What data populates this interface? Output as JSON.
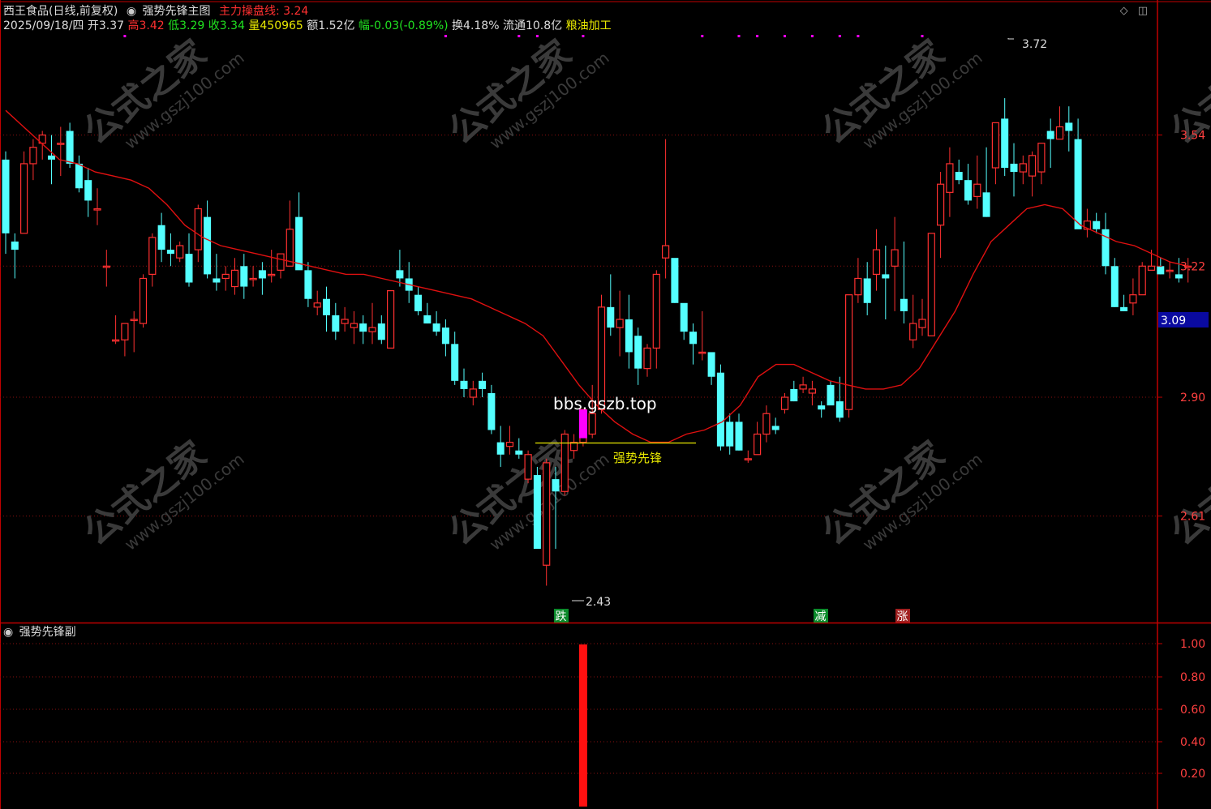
{
  "header": {
    "stock_name": "西王食品(日线,前复权)",
    "indicator_name": "强势先锋主图",
    "ma_label": "主力操盘线:",
    "ma_value": "3.24",
    "date": "2025/09/18/四",
    "open_label": "开",
    "open": "3.37",
    "high_label": "高",
    "high": "3.42",
    "low_label": "低",
    "low": "3.29",
    "close_label": "收",
    "close": "3.34",
    "volume_label": "量",
    "volume": "450965",
    "amount_label": "额",
    "amount": "1.52亿",
    "change_label": "幅",
    "change": "-0.03(-0.89%)",
    "turnover_label": "换",
    "turnover": "4.18%",
    "float_label": "流通",
    "float_cap": "10.8亿",
    "sector": "粮油加工"
  },
  "icons": {
    "diamond": "diamond-icon",
    "window": "window-toggle-icon"
  },
  "main_axis": {
    "ticks": [
      "3.54",
      "3.22",
      "2.90",
      "2.61"
    ],
    "current_price": "3.09"
  },
  "annotations": {
    "max_label": "3.72",
    "min_label": "2.43",
    "watermark_text": "bbs.gszb.top",
    "signal_label": "强势先锋",
    "marker_die": "跌",
    "marker_jian": "减",
    "marker_zhang": "涨",
    "wm1": "公式之家",
    "wm2": "www.gszj100.com"
  },
  "sub_panel": {
    "title": "强势先锋副",
    "ticks": [
      "1.00",
      "0.80",
      "0.60",
      "0.40",
      "0.20"
    ]
  },
  "colors": {
    "up": "#ff3030",
    "down": "#54ffff",
    "ma": "#e01010",
    "signal": "#ff00ff",
    "sub_bar": "#ff1010"
  },
  "chart_data": {
    "type": "candlestick",
    "ylim": [
      2.35,
      3.83
    ],
    "ohlc": [
      [
        3.48,
        3.5,
        3.25,
        3.3
      ],
      [
        3.28,
        3.3,
        3.19,
        3.26
      ],
      [
        3.3,
        3.5,
        3.3,
        3.47
      ],
      [
        3.47,
        3.53,
        3.43,
        3.51
      ],
      [
        3.52,
        3.55,
        3.48,
        3.54
      ],
      [
        3.49,
        3.54,
        3.42,
        3.48
      ],
      [
        3.52,
        3.56,
        3.44,
        3.52
      ],
      [
        3.55,
        3.57,
        3.46,
        3.47
      ],
      [
        3.47,
        3.49,
        3.4,
        3.41
      ],
      [
        3.43,
        3.46,
        3.34,
        3.38
      ],
      [
        3.36,
        3.41,
        3.32,
        3.36
      ],
      [
        3.22,
        3.26,
        3.17,
        3.22
      ],
      [
        3.04,
        3.1,
        3.03,
        3.04
      ],
      [
        3.04,
        3.08,
        3.0,
        3.08
      ],
      [
        3.09,
        3.11,
        3.01,
        3.09
      ],
      [
        3.08,
        3.2,
        3.07,
        3.19
      ],
      [
        3.2,
        3.3,
        3.17,
        3.29
      ],
      [
        3.32,
        3.35,
        3.23,
        3.26
      ],
      [
        3.26,
        3.3,
        3.22,
        3.25
      ],
      [
        3.24,
        3.28,
        3.23,
        3.27
      ],
      [
        3.25,
        3.3,
        3.17,
        3.18
      ],
      [
        3.26,
        3.37,
        3.23,
        3.36
      ],
      [
        3.34,
        3.38,
        3.19,
        3.2
      ],
      [
        3.19,
        3.25,
        3.16,
        3.18
      ],
      [
        3.19,
        3.22,
        3.16,
        3.2
      ],
      [
        3.17,
        3.24,
        3.15,
        3.21
      ],
      [
        3.22,
        3.25,
        3.14,
        3.17
      ],
      [
        3.19,
        3.22,
        3.17,
        3.19
      ],
      [
        3.21,
        3.23,
        3.15,
        3.19
      ],
      [
        3.2,
        3.26,
        3.18,
        3.2
      ],
      [
        3.21,
        3.25,
        3.19,
        3.25
      ],
      [
        3.22,
        3.38,
        3.22,
        3.31
      ],
      [
        3.34,
        3.4,
        3.25,
        3.21
      ],
      [
        3.21,
        3.23,
        3.12,
        3.14
      ],
      [
        3.12,
        3.16,
        3.1,
        3.13
      ],
      [
        3.14,
        3.17,
        3.06,
        3.1
      ],
      [
        3.1,
        3.13,
        3.04,
        3.06
      ],
      [
        3.08,
        3.12,
        3.06,
        3.09
      ],
      [
        3.07,
        3.11,
        3.03,
        3.08
      ],
      [
        3.08,
        3.1,
        3.03,
        3.06
      ],
      [
        3.06,
        3.13,
        3.03,
        3.07
      ],
      [
        3.08,
        3.1,
        3.03,
        3.04
      ],
      [
        3.02,
        3.16,
        3.02,
        3.16
      ],
      [
        3.21,
        3.26,
        3.17,
        3.19
      ],
      [
        3.19,
        3.23,
        3.13,
        3.16
      ],
      [
        3.15,
        3.17,
        3.1,
        3.11
      ],
      [
        3.1,
        3.13,
        3.08,
        3.08
      ],
      [
        3.08,
        3.11,
        3.05,
        3.06
      ],
      [
        3.07,
        3.09,
        3.0,
        3.03
      ],
      [
        3.03,
        3.06,
        2.93,
        2.94
      ],
      [
        2.94,
        2.97,
        2.9,
        2.92
      ],
      [
        2.9,
        2.94,
        2.88,
        2.92
      ],
      [
        2.94,
        2.96,
        2.9,
        2.92
      ],
      [
        2.91,
        2.93,
        2.81,
        2.82
      ],
      [
        2.79,
        2.83,
        2.73,
        2.76
      ],
      [
        2.78,
        2.83,
        2.76,
        2.79
      ],
      [
        2.77,
        2.8,
        2.75,
        2.76
      ],
      [
        2.7,
        2.77,
        2.69,
        2.76
      ],
      [
        2.71,
        2.73,
        2.58,
        2.53
      ],
      [
        2.49,
        2.75,
        2.44,
        2.74
      ],
      [
        2.7,
        2.73,
        2.53,
        2.67
      ],
      [
        2.67,
        2.82,
        2.66,
        2.81
      ],
      [
        2.77,
        2.81,
        2.75,
        2.79
      ],
      [
        2.79,
        2.86,
        2.78,
        2.87
      ],
      [
        2.81,
        2.93,
        2.8,
        2.86
      ],
      [
        2.87,
        3.15,
        2.86,
        3.12
      ],
      [
        3.12,
        3.2,
        3.05,
        3.07
      ],
      [
        3.07,
        3.16,
        3.0,
        3.09
      ],
      [
        3.09,
        3.15,
        2.97,
        3.01
      ],
      [
        3.05,
        3.07,
        2.93,
        2.97
      ],
      [
        2.97,
        3.03,
        2.95,
        3.02
      ],
      [
        3.02,
        3.21,
        2.97,
        3.2
      ],
      [
        3.24,
        3.53,
        3.19,
        3.27
      ],
      [
        3.24,
        3.22,
        3.13,
        3.13
      ],
      [
        3.13,
        3.09,
        3.04,
        3.06
      ],
      [
        3.06,
        3.08,
        2.98,
        3.03
      ],
      [
        3.01,
        3.11,
        2.99,
        3.01
      ],
      [
        3.01,
        2.96,
        2.93,
        2.95
      ],
      [
        2.96,
        2.98,
        2.77,
        2.78
      ],
      [
        2.84,
        2.86,
        2.76,
        2.78
      ],
      [
        2.84,
        2.86,
        2.77,
        2.77
      ],
      [
        2.75,
        2.77,
        2.74,
        2.75
      ],
      [
        2.76,
        2.84,
        2.76,
        2.81
      ],
      [
        2.81,
        2.88,
        2.79,
        2.86
      ],
      [
        2.83,
        2.85,
        2.81,
        2.82
      ],
      [
        2.87,
        2.91,
        2.86,
        2.9
      ],
      [
        2.92,
        2.94,
        2.89,
        2.89
      ],
      [
        2.92,
        2.95,
        2.91,
        2.93
      ],
      [
        2.91,
        2.94,
        2.88,
        2.92
      ],
      [
        2.88,
        2.89,
        2.85,
        2.87
      ],
      [
        2.93,
        2.94,
        2.89,
        2.88
      ],
      [
        2.89,
        2.95,
        2.84,
        2.85
      ],
      [
        2.87,
        3.15,
        2.85,
        3.15
      ],
      [
        3.15,
        3.24,
        3.13,
        3.19
      ],
      [
        3.19,
        3.23,
        3.1,
        3.13
      ],
      [
        3.2,
        3.31,
        3.16,
        3.26
      ],
      [
        3.2,
        3.27,
        3.09,
        3.19
      ],
      [
        3.22,
        3.34,
        3.11,
        3.26
      ],
      [
        3.14,
        3.28,
        3.08,
        3.11
      ],
      [
        3.04,
        3.15,
        3.02,
        3.08
      ],
      [
        3.07,
        3.14,
        3.05,
        3.09
      ],
      [
        3.05,
        3.29,
        3.05,
        3.3
      ],
      [
        3.32,
        3.45,
        3.24,
        3.42
      ],
      [
        3.4,
        3.51,
        3.34,
        3.47
      ],
      [
        3.45,
        3.48,
        3.42,
        3.43
      ],
      [
        3.43,
        3.47,
        3.37,
        3.38
      ],
      [
        3.39,
        3.49,
        3.36,
        3.42
      ],
      [
        3.4,
        3.51,
        3.34,
        3.34
      ],
      [
        3.46,
        3.55,
        3.42,
        3.57
      ],
      [
        3.58,
        3.63,
        3.44,
        3.46
      ],
      [
        3.47,
        3.52,
        3.39,
        3.45
      ],
      [
        3.45,
        3.49,
        3.42,
        3.47
      ],
      [
        3.44,
        3.5,
        3.39,
        3.49
      ],
      [
        3.45,
        3.51,
        3.42,
        3.52
      ],
      [
        3.55,
        3.58,
        3.46,
        3.53
      ],
      [
        3.53,
        3.61,
        3.53,
        3.56
      ],
      [
        3.57,
        3.61,
        3.5,
        3.55
      ],
      [
        3.53,
        3.58,
        3.38,
        3.31
      ],
      [
        3.31,
        3.36,
        3.29,
        3.33
      ],
      [
        3.33,
        3.35,
        3.3,
        3.31
      ],
      [
        3.31,
        3.35,
        3.2,
        3.22
      ],
      [
        3.22,
        3.24,
        3.12,
        3.12
      ],
      [
        3.12,
        3.15,
        3.11,
        3.11
      ],
      [
        3.13,
        3.19,
        3.1,
        3.15
      ],
      [
        3.15,
        3.23,
        3.15,
        3.22
      ],
      [
        3.21,
        3.26,
        3.21,
        3.22
      ],
      [
        3.22,
        3.24,
        3.2,
        3.2
      ],
      [
        3.21,
        3.23,
        3.19,
        3.21
      ],
      [
        3.2,
        3.24,
        3.18,
        3.19
      ],
      [
        3.22,
        3.24,
        3.18,
        3.22
      ]
    ],
    "ma_series": [
      3.6,
      3.56,
      3.52,
      3.48,
      3.47,
      3.45,
      3.44,
      3.43,
      3.41,
      3.37,
      3.32,
      3.29,
      3.27,
      3.26,
      3.25,
      3.24,
      3.23,
      3.22,
      3.21,
      3.2,
      3.2,
      3.19,
      3.18,
      3.17,
      3.16,
      3.15,
      3.14,
      3.12,
      3.1,
      3.08,
      3.05,
      2.99,
      2.93,
      2.88,
      2.84,
      2.81,
      2.79,
      2.79,
      2.81,
      2.82,
      2.84,
      2.88,
      2.95,
      2.98,
      2.98,
      2.96,
      2.94,
      2.93,
      2.92,
      2.92,
      2.93,
      2.97,
      3.04,
      3.11,
      3.2,
      3.28,
      3.32,
      3.36,
      3.37,
      3.36,
      3.32,
      3.3,
      3.28,
      3.27,
      3.25,
      3.23,
      3.22
    ],
    "sub_series": {
      "type": "bar",
      "ylim": [
        0,
        1.0
      ],
      "signal_index": 63,
      "value": 1.0
    }
  }
}
